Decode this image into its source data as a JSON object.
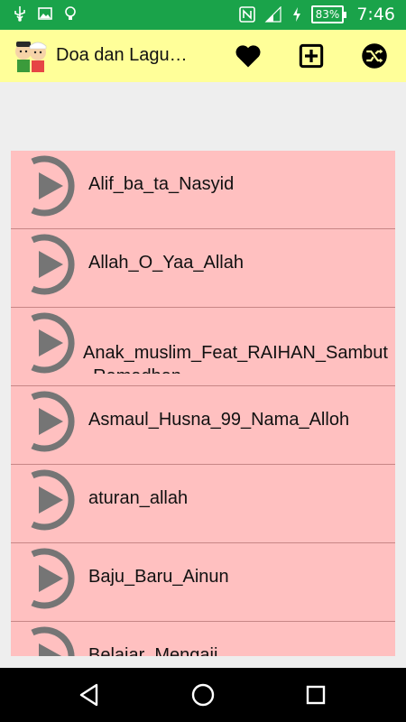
{
  "status_bar": {
    "battery": "83%",
    "time": "7:46",
    "icons": [
      "usb-icon",
      "image-icon",
      "bulb-icon",
      "nfc-icon",
      "signal-icon",
      "battery-icon"
    ]
  },
  "app_bar": {
    "title": "Doa dan Lagu…",
    "actions": [
      "favorite-icon",
      "add-icon",
      "shuffle-icon"
    ]
  },
  "songs": [
    "Alif_ba_ta_Nasyid",
    "Allah_O_Yaa_Allah",
    "Anak_muslim_Feat_RAIHAN_Sambut_Ramadhan",
    "Asmaul_Husna_99_Nama_Alloh",
    "aturan_allah",
    "Baju_Baru_Ainun",
    "Belajar_Mengaji"
  ],
  "colors": {
    "status_bar": "#1aa34a",
    "app_bar": "#ffff99",
    "list_bg": "#ffc0c0",
    "play_icon": "#757575"
  },
  "nav_bar": [
    "back-icon",
    "home-icon",
    "recents-icon"
  ]
}
